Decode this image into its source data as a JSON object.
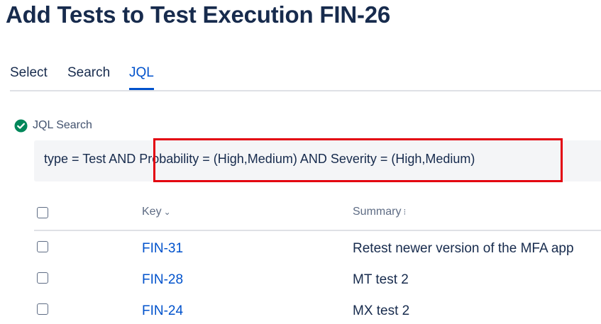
{
  "page": {
    "title": "Add Tests to Test Execution FIN-26"
  },
  "tabs": [
    {
      "label": "Select",
      "active": false
    },
    {
      "label": "Search",
      "active": false
    },
    {
      "label": "JQL",
      "active": true
    }
  ],
  "jql": {
    "label": "JQL Search",
    "status_icon": "check-circle-icon",
    "status_color": "#00875a",
    "query": "type = Test AND Probability = (High,Medium) AND Severity = (High,Medium)",
    "highlighted_text": "Probability = (High,Medium) AND Severity = (High,Medium)",
    "highlight_color": "#e3000f"
  },
  "table": {
    "columns": [
      {
        "label": "",
        "type": "checkbox"
      },
      {
        "label": "Key",
        "sort_icon": "⌄"
      },
      {
        "label": "Summary",
        "sort_icon": "⁝"
      }
    ],
    "rows": [
      {
        "key": "FIN-31",
        "summary": "Retest newer version of the MFA app",
        "checked": false
      },
      {
        "key": "FIN-28",
        "summary": "MT test 2",
        "checked": false
      },
      {
        "key": "FIN-24",
        "summary": "MX test 2",
        "checked": false
      }
    ]
  },
  "colors": {
    "link": "#0052cc",
    "text": "#172b4d",
    "input_bg": "#f4f5f7"
  }
}
